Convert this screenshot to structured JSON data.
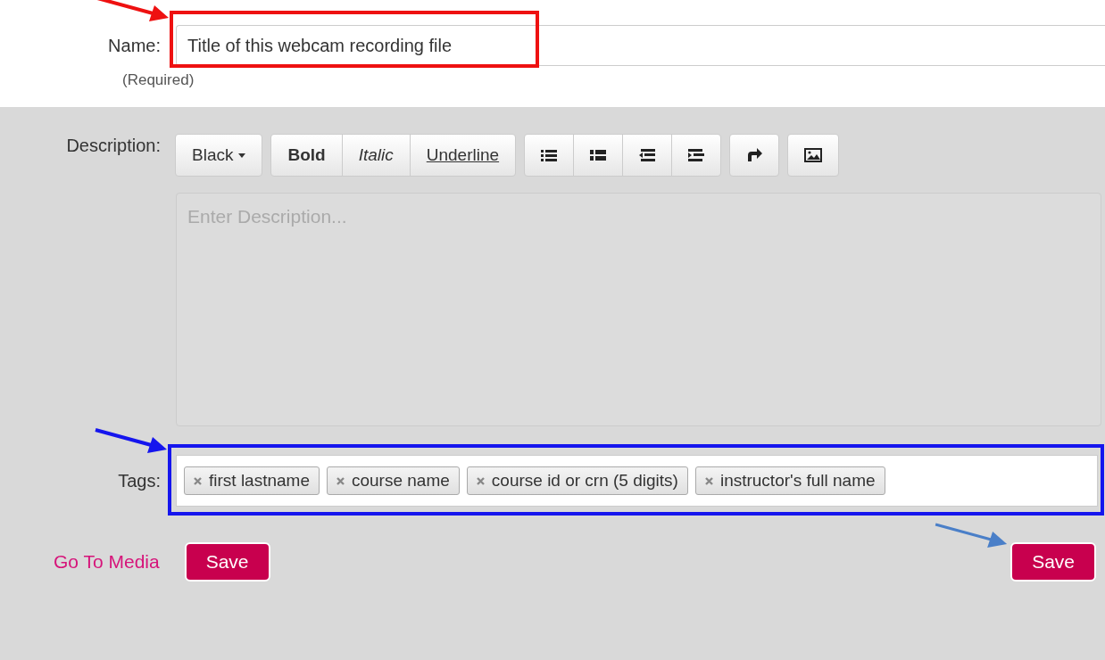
{
  "name_field": {
    "label": "Name:",
    "value": "Title of this webcam recording file",
    "hint": "(Required)"
  },
  "description": {
    "label": "Description:",
    "toolbar": [
      {
        "kind": "dropdown",
        "label": "Black"
      },
      {
        "kind": "bold",
        "label": "Bold"
      },
      {
        "kind": "italic",
        "label": "Italic"
      },
      {
        "kind": "underline",
        "label": "Underline"
      }
    ],
    "placeholder": "Enter Description..."
  },
  "tags": {
    "label": "Tags:",
    "items": [
      "first lastname",
      "course name",
      "course id or crn (5 digits)",
      "instructor's full name"
    ]
  },
  "actions": [
    {
      "kind": "link",
      "label": "Go To Media"
    },
    {
      "kind": "primary",
      "label": "Save"
    }
  ],
  "corner_button": {
    "label": "Save"
  }
}
